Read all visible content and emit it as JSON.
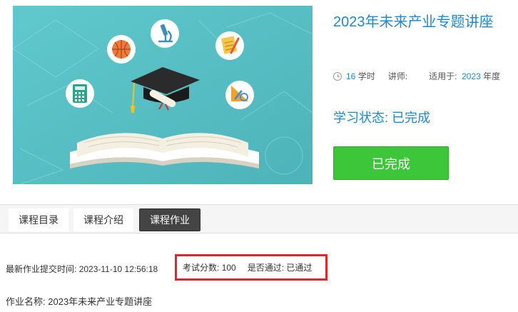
{
  "course": {
    "title": "2023年未来产业专题讲座",
    "hours_value": "16",
    "hours_unit": "学时",
    "lecturer_label": "讲师:",
    "applies_label": "适用于:",
    "applies_year": "2023",
    "applies_unit": "年度",
    "status_label": "学习状态:",
    "status_value": "已完成",
    "button_label": "已完成"
  },
  "tabs": [
    {
      "label": "课程目录",
      "active": false
    },
    {
      "label": "课程介绍",
      "active": false
    },
    {
      "label": "课程作业",
      "active": true
    }
  ],
  "homework": {
    "submit_time_label": "最新作业提交时间:",
    "submit_time_value": "2023-11-10 12:56:18",
    "score_label": "考试分数:",
    "score_value": "100",
    "pass_label": "是否通过:",
    "pass_value": "已通过",
    "name_label": "作业名称:",
    "name_value": "2023年未来产业专题讲座"
  },
  "colors": {
    "accent_blue": "#1e88d4",
    "button_green": "#3ec63a",
    "highlight_red": "#e3262c",
    "banner_teal": "#57c0c6"
  },
  "banner_icons": [
    "calculator-icon",
    "basketball-icon",
    "microscope-icon",
    "notepad-icon",
    "protractor-icon",
    "graduation-cap-icon",
    "open-book-icon"
  ]
}
